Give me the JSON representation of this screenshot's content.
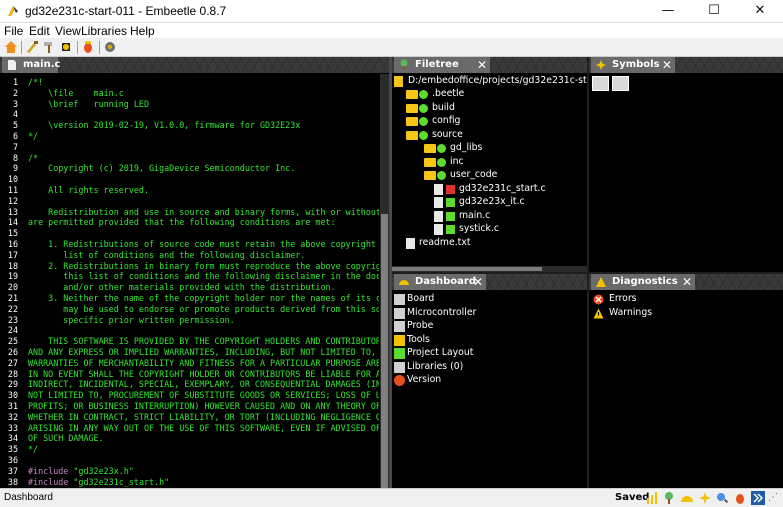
{
  "window": {
    "title": "gd32e231c-start-011 - Embeetle 0.8.7",
    "minimize": "—",
    "maximize": "☐",
    "close": "✕"
  },
  "menu": [
    "File",
    "Edit",
    "View",
    "Libraries",
    "Help"
  ],
  "editor": {
    "tab_label": "main.c",
    "lines": [
      {
        "n": "1",
        "t": "/*!",
        "k": "c"
      },
      {
        "n": "2",
        "t": "    \\file    main.c",
        "k": "c"
      },
      {
        "n": "3",
        "t": "    \\brief   running LED",
        "k": "c"
      },
      {
        "n": "4",
        "t": "",
        "k": "c"
      },
      {
        "n": "5",
        "t": "    \\version 2019-02-19, V1.0.0, firmware for GD32E23x",
        "k": "c"
      },
      {
        "n": "6",
        "t": "*/",
        "k": "c"
      },
      {
        "n": "7",
        "t": "",
        "k": "c"
      },
      {
        "n": "8",
        "t": "/*",
        "k": "c"
      },
      {
        "n": "9",
        "t": "    Copyright (c) 2019, GigaDevice Semiconductor Inc.",
        "k": "c"
      },
      {
        "n": "10",
        "t": "",
        "k": "c"
      },
      {
        "n": "11",
        "t": "    All rights reserved.",
        "k": "c"
      },
      {
        "n": "12",
        "t": "",
        "k": "c"
      },
      {
        "n": "13",
        "t": "    Redistribution and use in source and binary forms, with or without",
        "k": "c"
      },
      {
        "n": "14",
        "t": "are permitted provided that the following conditions are met:",
        "k": "c"
      },
      {
        "n": "15",
        "t": "",
        "k": "c"
      },
      {
        "n": "16",
        "t": "    1. Redistributions of source code must retain the above copyright n",
        "k": "c"
      },
      {
        "n": "17",
        "t": "       list of conditions and the following disclaimer.",
        "k": "c"
      },
      {
        "n": "18",
        "t": "    2. Redistributions in binary form must reproduce the above copyrigh",
        "k": "c"
      },
      {
        "n": "19",
        "t": "       this list of conditions and the following disclaimer in the docu",
        "k": "c"
      },
      {
        "n": "20",
        "t": "       and/or other materials provided with the distribution.",
        "k": "c"
      },
      {
        "n": "21",
        "t": "    3. Neither the name of the copyright holder nor the names of its co",
        "k": "c"
      },
      {
        "n": "22",
        "t": "       may be used to endorse or promote products derived from this sof",
        "k": "c"
      },
      {
        "n": "23",
        "t": "       specific prior written permission.",
        "k": "c"
      },
      {
        "n": "24",
        "t": "",
        "k": "c"
      },
      {
        "n": "25",
        "t": "    THIS SOFTWARE IS PROVIDED BY THE COPYRIGHT HOLDERS AND CONTRIBUTORS",
        "k": "c"
      },
      {
        "n": "26",
        "t": "AND ANY EXPRESS OR IMPLIED WARRANTIES, INCLUDING, BUT NOT LIMITED TO, T",
        "k": "c"
      },
      {
        "n": "27",
        "t": "WARRANTIES OF MERCHANTABILITY AND FITNESS FOR A PARTICULAR PURPOSE ARE",
        "k": "c"
      },
      {
        "n": "28",
        "t": "IN NO EVENT SHALL THE COPYRIGHT HOLDER OR CONTRIBUTORS BE LIABLE FOR AN",
        "k": "c"
      },
      {
        "n": "29",
        "t": "INDIRECT, INCIDENTAL, SPECIAL, EXEMPLARY, OR CONSEQUENTIAL DAMAGES (INC",
        "k": "c"
      },
      {
        "n": "30",
        "t": "NOT LIMITED TO, PROCUREMENT OF SUBSTITUTE GOODS OR SERVICES; LOSS OF U",
        "k": "c"
      },
      {
        "n": "31",
        "t": "PROFITS; OR BUSINESS INTERRUPTION) HOWEVER CAUSED AND ON ANY THEORY OF",
        "k": "c"
      },
      {
        "n": "32",
        "t": "WHETHER IN CONTRACT, STRICT LIABILITY, OR TORT (INCLUDING NEGLIGENCE OR",
        "k": "c"
      },
      {
        "n": "33",
        "t": "ARISING IN ANY WAY OUT OF THE USE OF THIS SOFTWARE, EVEN IF ADVISED OF",
        "k": "c"
      },
      {
        "n": "34",
        "t": "OF SUCH DAMAGE.",
        "k": "c"
      },
      {
        "n": "35",
        "t": "*/",
        "k": "c"
      },
      {
        "n": "36",
        "t": "",
        "k": "c"
      },
      {
        "n": "37",
        "t": "#include \"gd32e23x.h\"",
        "k": "i",
        "kw": "#include",
        "str": "\"gd32e23x.h\""
      },
      {
        "n": "38",
        "t": "#include \"gd32e231c_start.h\"",
        "k": "i",
        "kw": "#include",
        "str": "\"gd32e231c_start.h\""
      }
    ]
  },
  "filetree": {
    "tab_label": "Filetree",
    "root": "D:/embedoffice/projects/gd32e231c-st",
    "items": [
      {
        "label": ".beetle",
        "depth": 1,
        "kind": "folder"
      },
      {
        "label": "build",
        "depth": 1,
        "kind": "folder"
      },
      {
        "label": "config",
        "depth": 1,
        "kind": "folder"
      },
      {
        "label": "source",
        "depth": 1,
        "kind": "folder"
      },
      {
        "label": "gd_libs",
        "depth": 2,
        "kind": "folder"
      },
      {
        "label": "inc",
        "depth": 2,
        "kind": "folder"
      },
      {
        "label": "user_code",
        "depth": 2,
        "kind": "folder"
      },
      {
        "label": "gd32e231c_start.c",
        "depth": 3,
        "kind": "file"
      },
      {
        "label": "gd32e23x_it.c",
        "depth": 3,
        "kind": "file"
      },
      {
        "label": "main.c",
        "depth": 3,
        "kind": "file"
      },
      {
        "label": "systick.c",
        "depth": 3,
        "kind": "file"
      },
      {
        "label": "readme.txt",
        "depth": 1,
        "kind": "file"
      }
    ]
  },
  "symbols": {
    "tab_label": "Symbols"
  },
  "dashboard": {
    "tab_label": "Dashboard",
    "items": [
      "Board",
      "Microcontroller",
      "Probe",
      "Tools",
      "Project Layout",
      "Libraries (0)",
      "Version"
    ]
  },
  "diagnostics": {
    "tab_label": "Diagnostics",
    "items": [
      "Errors",
      "Warnings"
    ]
  },
  "statusbar": {
    "text": "Dashboard",
    "saved": "Saved"
  },
  "colors": {
    "code_green": "#32e632",
    "preprocessor": "#c583c5",
    "tab_gray": "#6a6a6a"
  }
}
